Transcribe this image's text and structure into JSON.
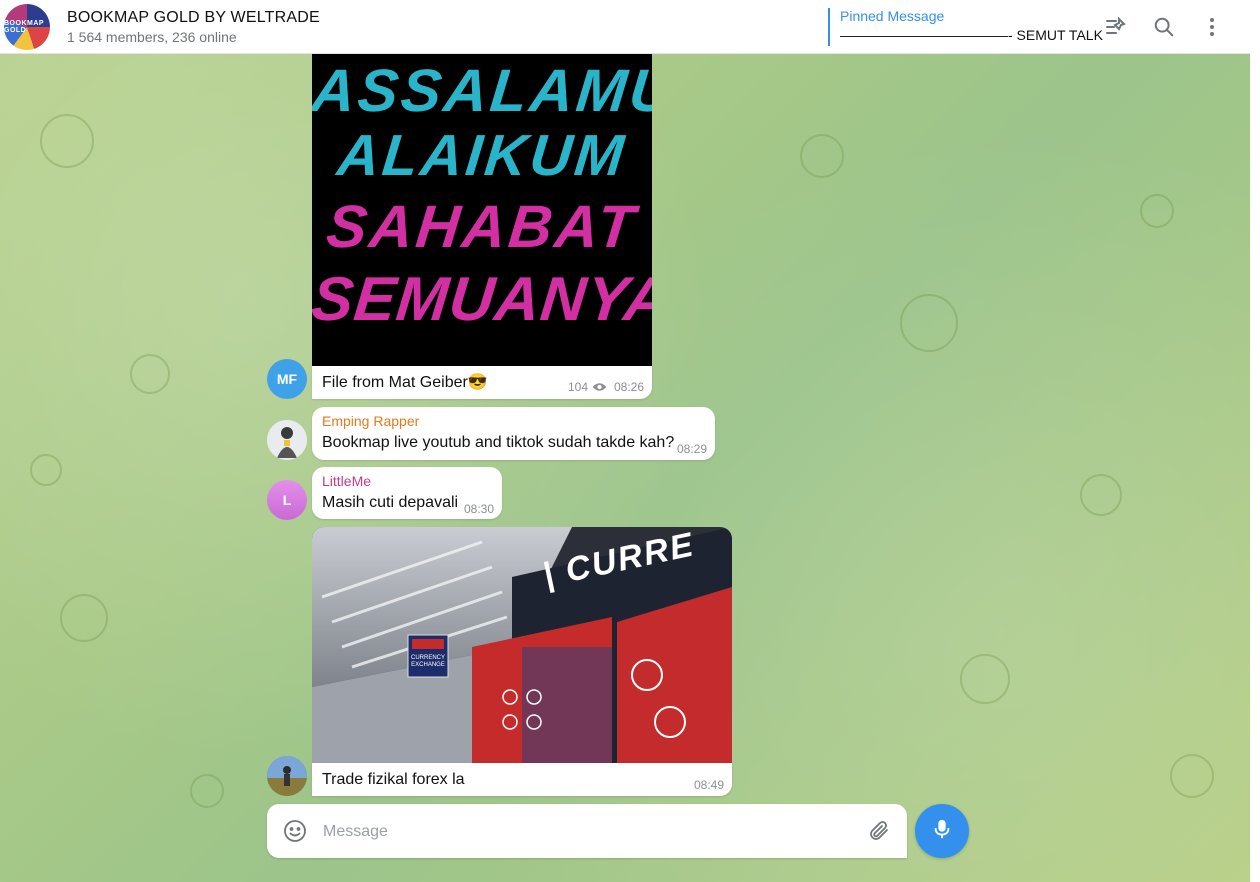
{
  "header": {
    "avatar_text": "BOOKMAP GOLD",
    "title": "BOOKMAP GOLD BY WELTRADE",
    "subtitle": "1 564 members, 236 online",
    "pinned_label": "Pinned Message",
    "pinned_text": "————————————- SEMUT TALK",
    "icons": [
      "pinned-list-icon",
      "search-icon",
      "more-vertical-icon"
    ]
  },
  "messages": [
    {
      "type": "image",
      "poster_lines": [
        "ASSALAMU'",
        "ALAIKUM",
        "SAHABAT",
        "SEMUANYA"
      ],
      "caption": "File from Mat Geiber😎",
      "views": "104",
      "time": "08:26",
      "avatar_initials": "MF",
      "avatar_color": "#3fa2e8"
    },
    {
      "type": "text",
      "sender": "Emping Rapper",
      "sender_color": "#e8791c",
      "text": "Bookmap live youtub and tiktok sudah takde kah?",
      "time": "08:29"
    },
    {
      "type": "text",
      "sender": "LittleMe",
      "sender_color": "#c03d8d",
      "text": "Masih cuti depavali",
      "time": "08:30",
      "avatar_initials": "L",
      "avatar_color": "#d77ae0"
    },
    {
      "type": "photo",
      "photo_sign": "| CURRE",
      "photo_small_sign": "CURRENCY EXCHANGE",
      "caption": "Trade fizikal forex la",
      "time": "08:49"
    }
  ],
  "composer": {
    "placeholder": "Message"
  },
  "colors": {
    "accent": "#3390ec",
    "poster_cyan": "#2ab4c9",
    "poster_magenta": "#d22fa3"
  }
}
